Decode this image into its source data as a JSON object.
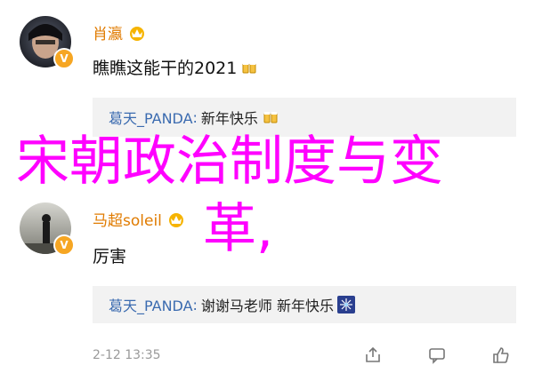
{
  "comments": [
    {
      "username": "肖瀛",
      "text": "瞧瞧这能干的2021",
      "reply": {
        "user": "葛天_PANDA",
        "separator": ":",
        "text": "新年快乐"
      }
    },
    {
      "username": "马超soleil",
      "text": "厉害",
      "reply": {
        "user": "葛天_PANDA",
        "separator": ":",
        "text": "谢谢马老师 新年快乐"
      },
      "timestamp": "2-12 13:35"
    }
  ],
  "overlay": {
    "line1": "宋朝政治制度与变",
    "line2": "革,"
  },
  "icons": {
    "verify": "verified-badge-icon",
    "crown": "crown-badge-icon",
    "share": "share-icon",
    "comment": "comment-icon",
    "like": "like-icon"
  },
  "colors": {
    "username": "#e07b00",
    "reply_user": "#3b6bb0",
    "overlay": "#ff00ff",
    "reply_bg": "#f2f2f2"
  }
}
